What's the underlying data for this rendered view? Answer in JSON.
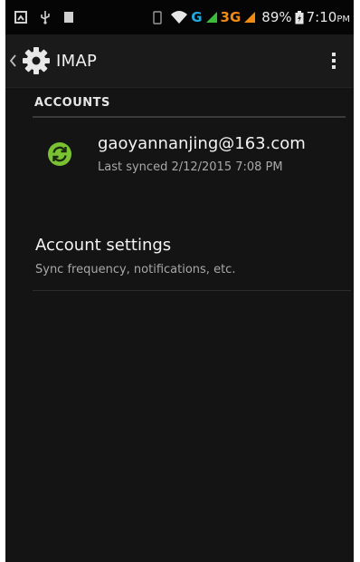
{
  "status_bar": {
    "network_g": "G",
    "network_3g": "3G",
    "battery_percent": "89%",
    "time": "7:10",
    "ampm": "PM",
    "icons": [
      "notification-icon",
      "usb-icon",
      "sd-card-icon",
      "sim-icon",
      "wifi-icon",
      "signal-icon",
      "battery-icon"
    ]
  },
  "action_bar": {
    "title": "IMAP",
    "app_icon": "settings-gear-icon",
    "overflow_icon": "overflow-menu-icon"
  },
  "accounts_section": {
    "header": "ACCOUNTS",
    "account": {
      "email": "gaoyannanjing@163.com",
      "last_synced": "Last synced 2/12/2015 7:08 PM",
      "icon": "sync-icon",
      "icon_color": "#7ac231"
    }
  },
  "settings_item": {
    "title": "Account settings",
    "subtitle": "Sync frequency, notifications, etc."
  },
  "colors": {
    "background": "#141414",
    "status_bar": "#050505",
    "accent_green": "#7ac231",
    "network_blue": "#22a8e0",
    "network_orange": "#f08a10"
  }
}
